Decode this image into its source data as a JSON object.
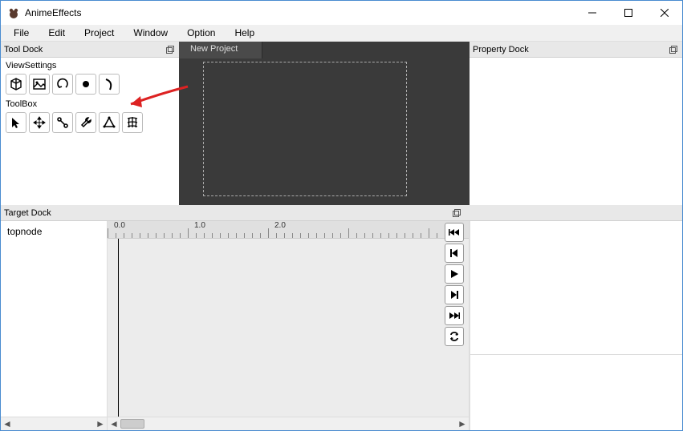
{
  "window": {
    "title": "AnimeEffects"
  },
  "menu": {
    "file": "File",
    "edit": "Edit",
    "project": "Project",
    "window": "Window",
    "option": "Option",
    "help": "Help"
  },
  "tool_dock": {
    "title": "Tool Dock",
    "view_settings_label": "ViewSettings",
    "toolbox_label": "ToolBox"
  },
  "canvas": {
    "tab_label": "New Project"
  },
  "property_dock": {
    "title": "Property Dock"
  },
  "target_dock": {
    "title": "Target Dock",
    "topnode": "topnode"
  },
  "timeline": {
    "marks": {
      "m0": "0.0",
      "m1": "1.0",
      "m2": "2.0"
    }
  }
}
